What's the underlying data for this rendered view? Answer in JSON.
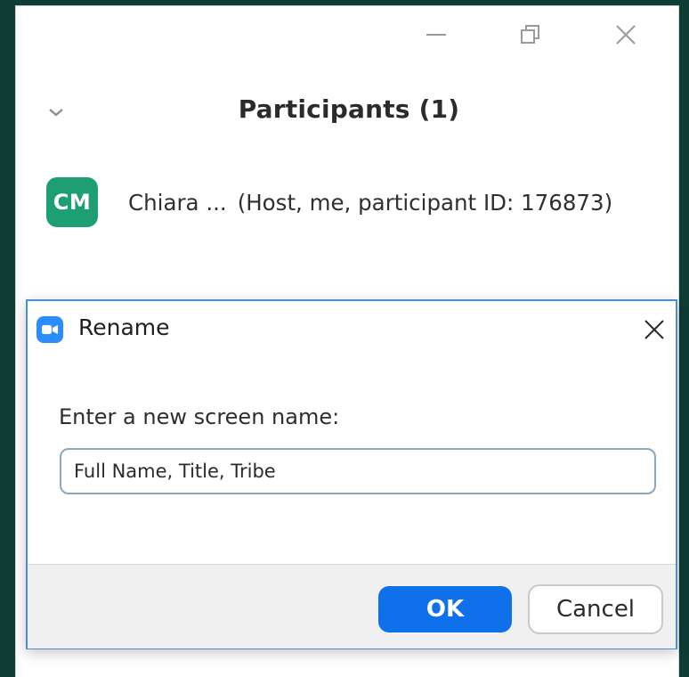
{
  "window": {
    "controls": [
      "minimize-icon",
      "restore-icon",
      "close-icon"
    ]
  },
  "participants_panel": {
    "title": "Participants (1)",
    "collapse_icon": "chevron-down-icon",
    "participants": [
      {
        "initials": "CM",
        "avatar_color": "#1e9e73",
        "name": "Chiara ...",
        "details": "(Host, me, participant ID: 176873)"
      }
    ]
  },
  "rename_dialog": {
    "icon": "zoom-camera-icon",
    "title": "Rename",
    "close_icon": "close-icon",
    "label": "Enter a new screen name:",
    "input_value": "Full Name, Title, Tribe",
    "ok_label": "OK",
    "cancel_label": "Cancel"
  },
  "colors": {
    "primary_button": "#0e71eb",
    "zoom_icon": "#2d8cff",
    "background": "#0e3d36"
  }
}
